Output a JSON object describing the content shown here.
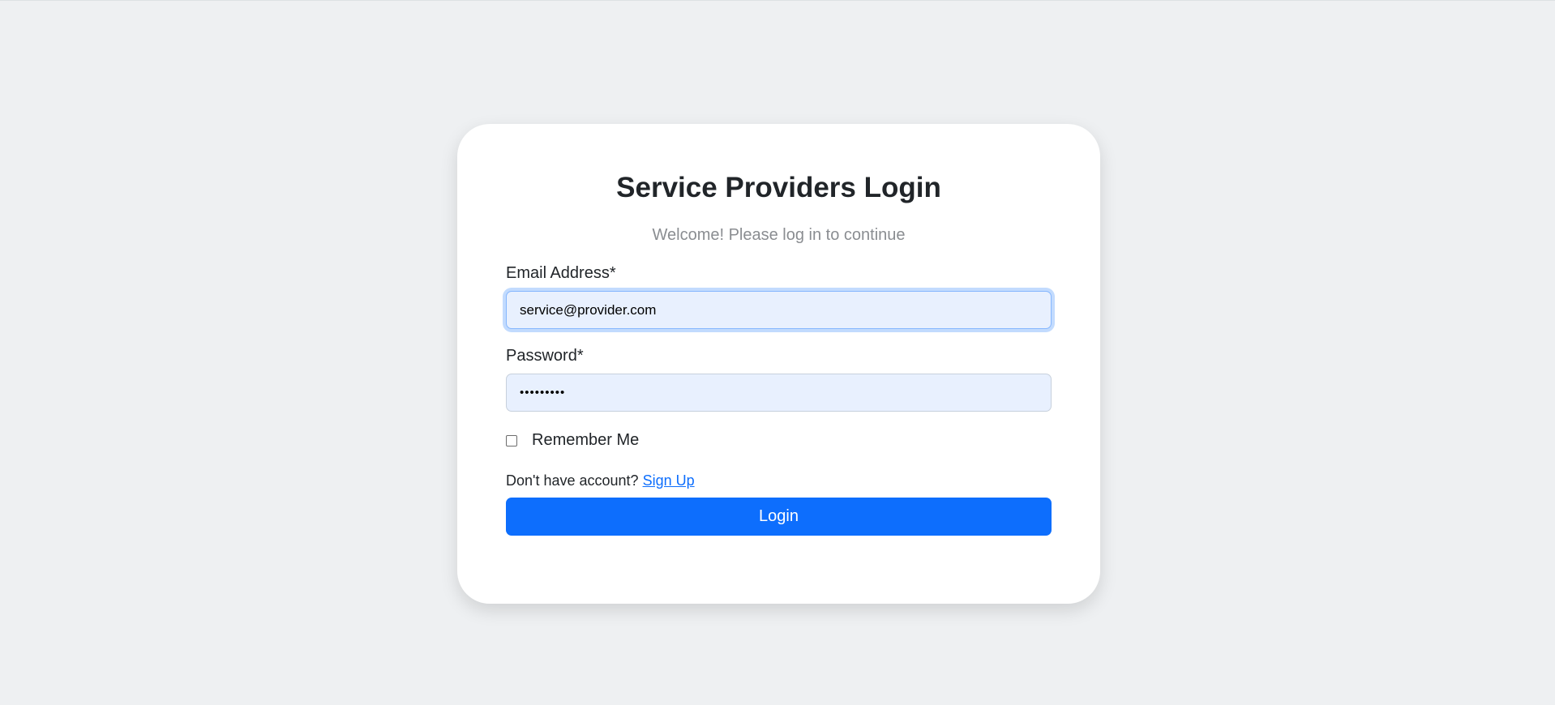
{
  "login": {
    "title": "Service Providers Login",
    "subtitle": "Welcome! Please log in to continue",
    "email": {
      "label": "Email Address*",
      "value": "service@provider.com"
    },
    "password": {
      "label": "Password*",
      "value": "•••••••••"
    },
    "remember_me": {
      "label": "Remember Me",
      "checked": false
    },
    "signup": {
      "prompt": "Don't have account?",
      "link_text": "Sign Up"
    },
    "login_button": "Login"
  },
  "colors": {
    "page_background": "#eef0f2",
    "card_background": "#ffffff",
    "primary": "#0d6efd",
    "input_fill": "#e8f0fe",
    "text": "#212529",
    "muted_text": "#8a8d91"
  }
}
